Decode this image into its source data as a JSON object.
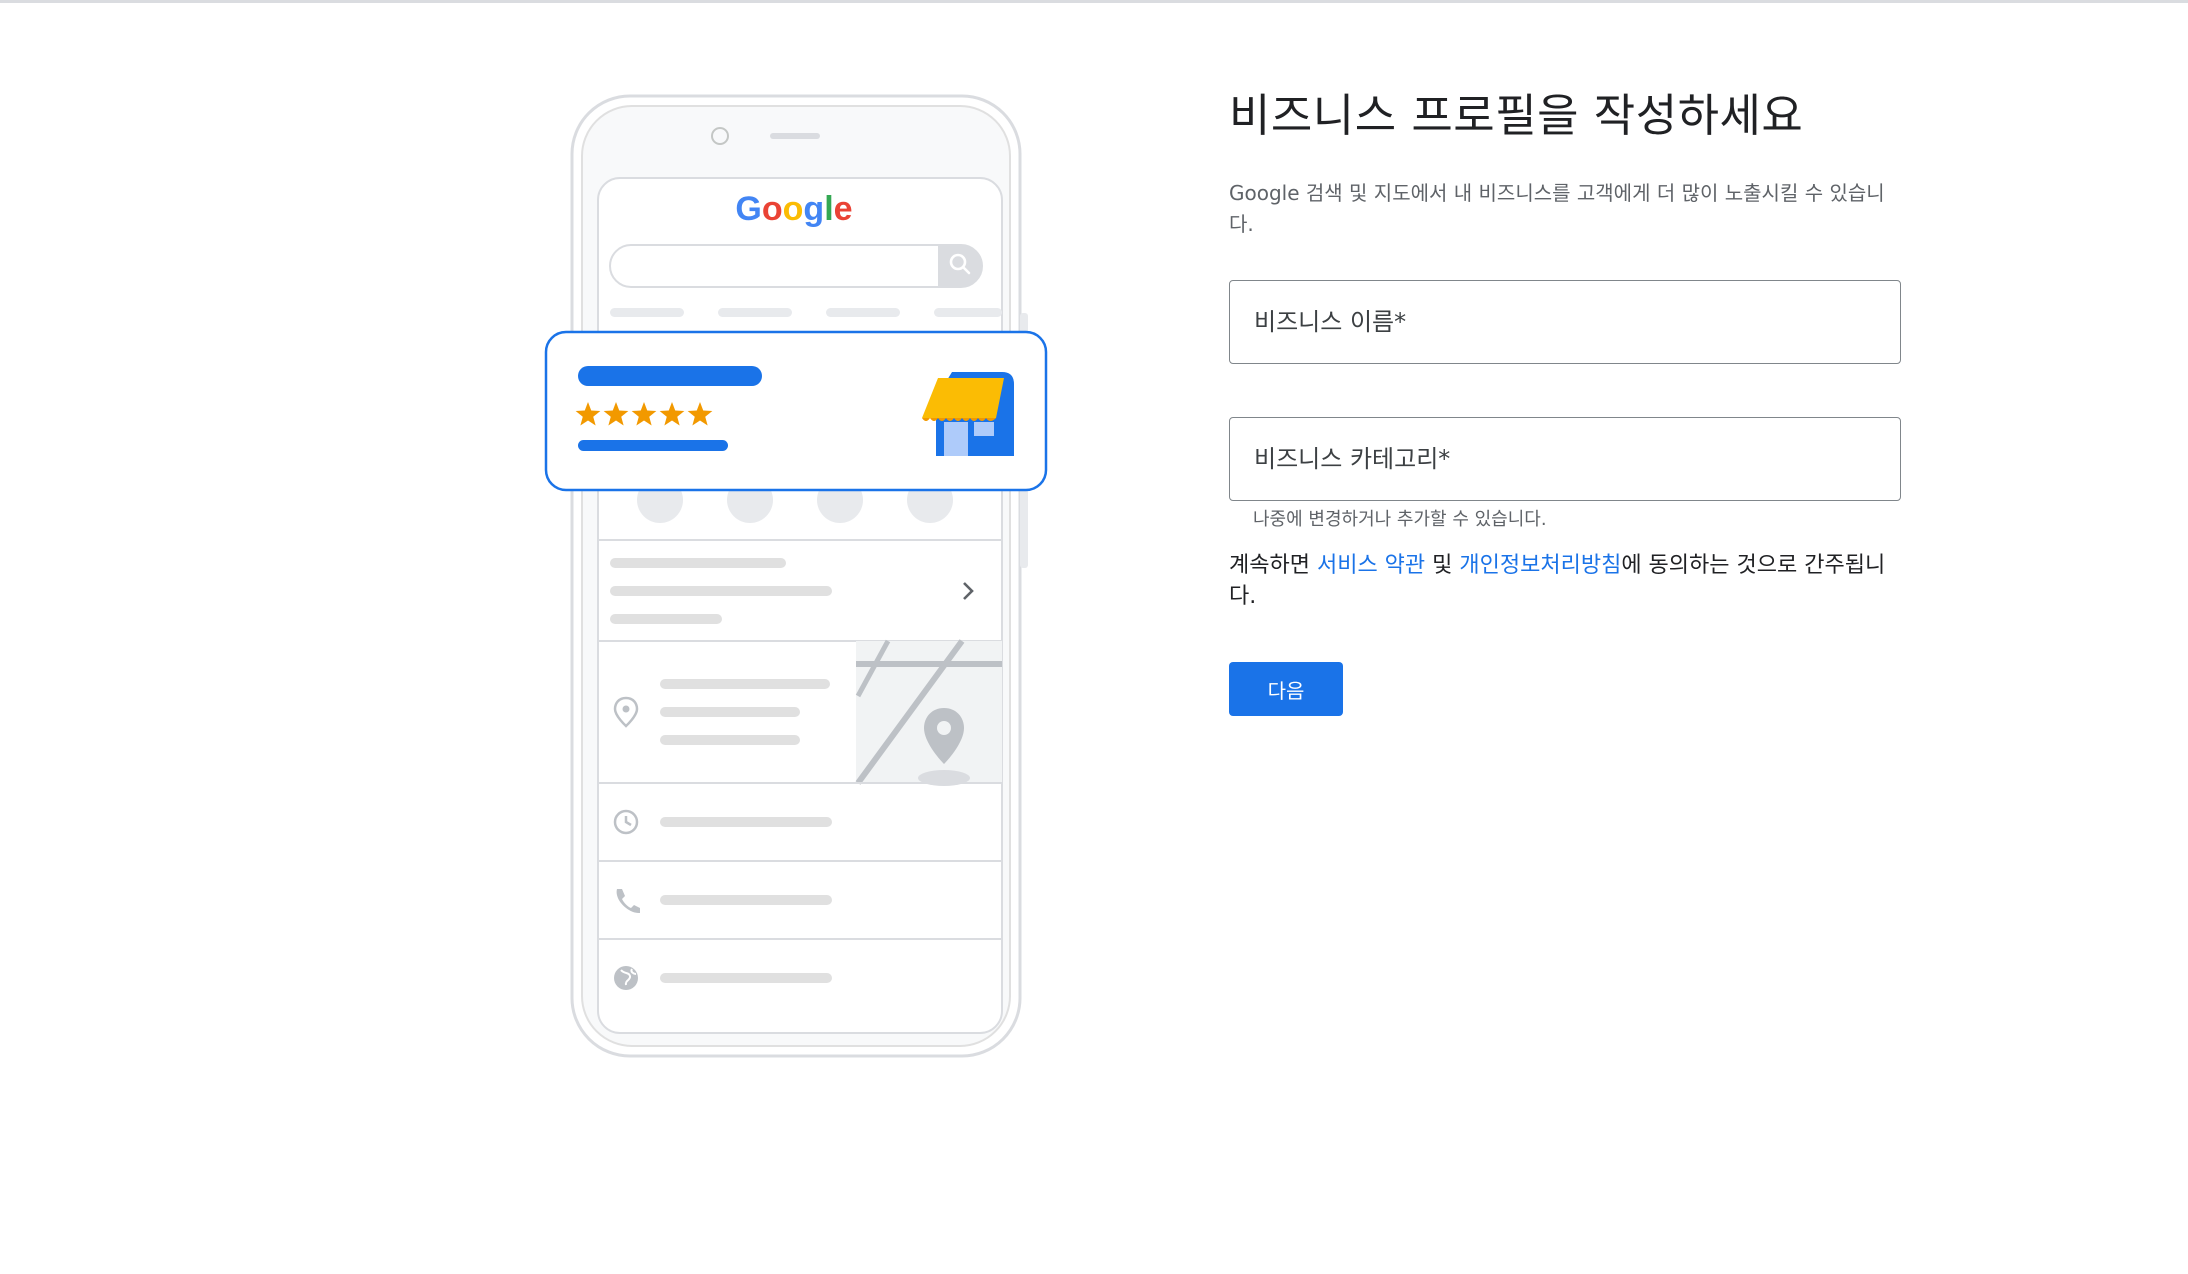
{
  "illustration": {
    "google_logo": "Google",
    "rating_stars": 5,
    "colors": {
      "google_blue": "#4285F4",
      "google_red": "#EA4335",
      "google_yellow": "#FBBC04",
      "google_green": "#34A853",
      "star": "#F29900",
      "placeholder_bar": "#1A73E8"
    }
  },
  "form": {
    "title": "비즈니스 프로필을 작성하세요",
    "subtitle": "Google 검색 및 지도에서 내 비즈니스를 고객에게 더 많이 노출시킬 수 있습니다.",
    "business_name_placeholder": "비즈니스 이름*",
    "business_category_placeholder": "비즈니스 카테고리*",
    "category_helper": "나중에 변경하거나 추가할 수 있습니다.",
    "terms": {
      "prefix": "계속하면 ",
      "terms_link": "서비스 약관",
      "middle": " 및 ",
      "privacy_link": "개인정보처리방침",
      "suffix": "에 동의하는 것으로 간주됩니다."
    },
    "next_button": "다음"
  }
}
